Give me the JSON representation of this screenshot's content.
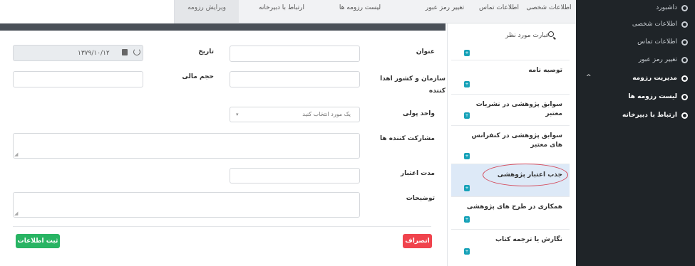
{
  "tabs": [
    {
      "label": "اطلاعات شخصی"
    },
    {
      "label": "اطلاعات تماس"
    },
    {
      "label": "تغییر رمز عبور"
    },
    {
      "label": "لیست رزومه ها"
    },
    {
      "label": "ارتباط با دبیرخانه"
    },
    {
      "label": "ویرایش رزومه"
    }
  ],
  "sidebar": {
    "items": [
      {
        "label": "داشبورد"
      },
      {
        "label": "اطلاعات شخصی"
      },
      {
        "label": "اطلاعات تماس"
      },
      {
        "label": "تغییر رمز عبور"
      },
      {
        "label": "مدیریت رزومه"
      },
      {
        "label": "لیست رزومه ها"
      },
      {
        "label": "ارتباط با دبیرخانه"
      }
    ],
    "caret": "^"
  },
  "sections": {
    "search_placeholder": "عبارت مورد نظر",
    "badge": "+",
    "items": [
      {
        "label": "توصیه نامه"
      },
      {
        "label": "سوابق پژوهشی در نشریات معتبر"
      },
      {
        "label": "سوابق پژوهشی در کنفرانس های معتبر"
      },
      {
        "label": "جذب اعتبار پژوهشی"
      },
      {
        "label": "همکاری در طرح های پژوهشی"
      },
      {
        "label": "نگارش یا ترجمه کتاب"
      }
    ]
  },
  "form": {
    "title_label": "عنوان",
    "date_label": "تاریخ",
    "date_value": "۱۳۷۹/۱۰/۱۲",
    "org_label": "سازمان و کشور اهدا کننده",
    "amount_label": "حجم مالی",
    "currency_label": "واحد پولی",
    "currency_placeholder": "یک مورد انتخاب کنید",
    "participants_label": "مشارکت کننده ها",
    "duration_label": "مدت اعتبار",
    "notes_label": "توضیحات",
    "cancel_label": "انصراف",
    "submit_label": "ثبت اطلاعات"
  },
  "colors": {
    "sidebar_bg": "#1f2428",
    "submit": "#28b463",
    "cancel": "#f0434d",
    "active_section": "#dde9f7",
    "badge": "#17a2b8",
    "highlight": "#d44a5b"
  }
}
